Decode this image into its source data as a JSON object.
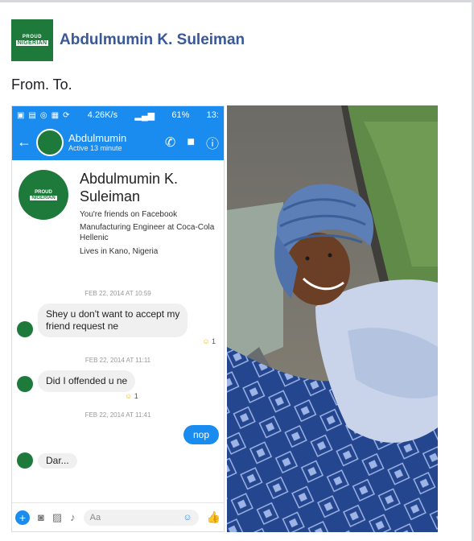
{
  "post": {
    "author": "Abdulmumin K.  Suleiman",
    "text": "From. To.",
    "avatar_line1": "PROUD",
    "avatar_line2": "NIGERIAN"
  },
  "left_screenshot": {
    "status_bar": {
      "speed": "4.26K/s",
      "battery": "61%",
      "time": "13:"
    },
    "header": {
      "name": "Abdulmumin",
      "status": "Active 13 minute"
    },
    "profile": {
      "name_line1": "Abdulmumin K.",
      "name_line2": "Suleiman",
      "friends": "You're friends on Facebook",
      "job_line1": "Manufacturing Engineer at Coca-Cola",
      "job_line2": "Hellenic",
      "location": "Lives in Kano, Nigeria",
      "avatar_line1": "PROUD",
      "avatar_line2": "NIGERIAN"
    },
    "messages": [
      {
        "timestamp": "FEB 22, 2014 AT 10:59",
        "text_line1": "Shey u don't want to accept my",
        "text_line2": "friend request ne",
        "reaction_count": "1"
      },
      {
        "timestamp": "FEB 22, 2014 AT 11:11",
        "text": "Did I offended u ne",
        "reaction_count": "1"
      },
      {
        "timestamp": "FEB 22, 2014 AT 11:41",
        "outgoing": "nop"
      }
    ],
    "partial_message": "Dar...",
    "composer": {
      "placeholder": "Aa"
    },
    "icons": {
      "back": "back-arrow-icon",
      "call": "phone-icon",
      "video": "video-icon",
      "info": "info-icon",
      "plus": "plus-icon",
      "camera": "camera-icon",
      "gallery": "image-icon",
      "mic": "microphone-icon",
      "emoji": "emoji-icon",
      "like": "thumbs-up-icon"
    }
  },
  "colors": {
    "messenger_blue": "#1a8cf0",
    "facebook_link": "#385898",
    "nigerian_green": "#1d7a3a"
  }
}
